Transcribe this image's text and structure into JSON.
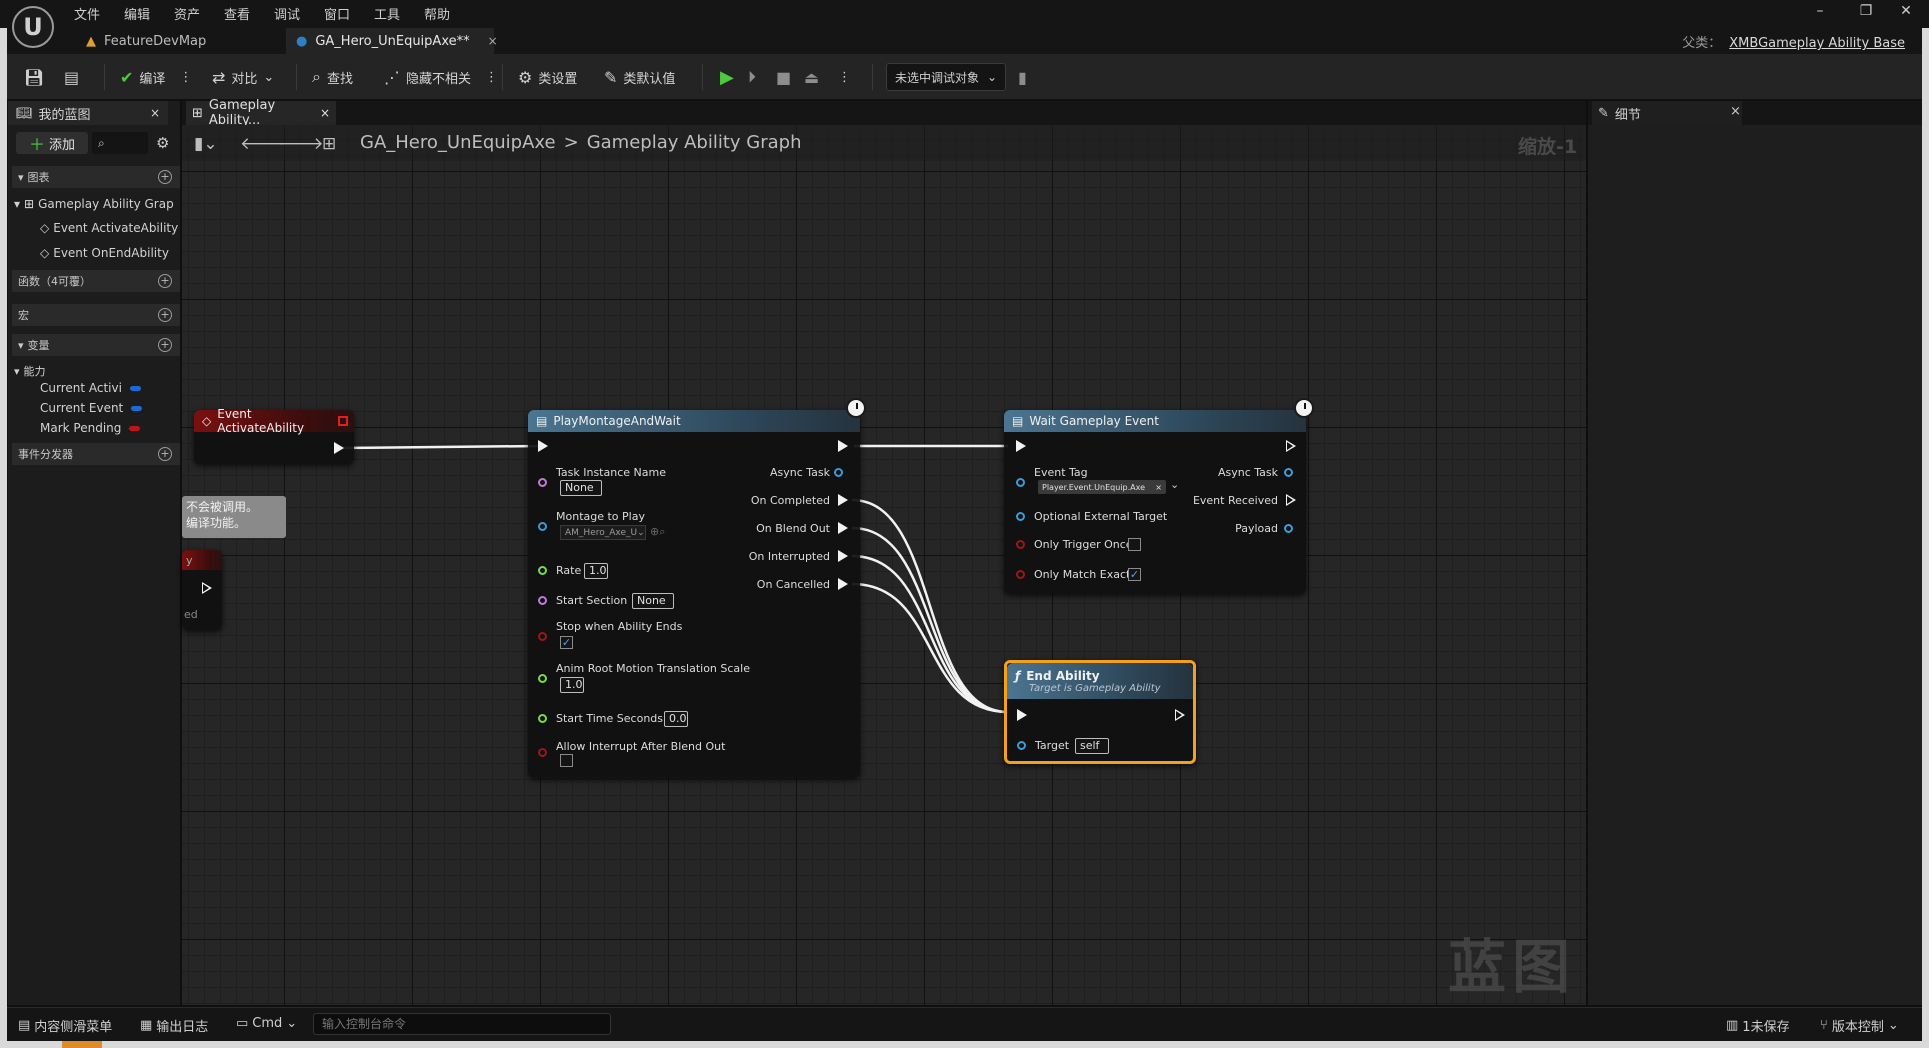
{
  "logo": "U",
  "menu": [
    "文件",
    "编辑",
    "资产",
    "查看",
    "调试",
    "窗口",
    "工具",
    "帮助"
  ],
  "window_controls": {
    "minimize": "–",
    "restore": "❐",
    "close": "✕"
  },
  "tabs": {
    "map_tab": "FeatureDevMap",
    "asset_tab": "GA_Hero_UnEquipAxe**",
    "close": "×"
  },
  "parent": {
    "label": "父类：",
    "value": "XMBGameplay Ability Base"
  },
  "toolbar": {
    "compile": "编译",
    "diff": "对比",
    "find": "查找",
    "hide_unrelated": "隐藏不相关",
    "class_settings": "类设置",
    "class_defaults": "类默认值",
    "debug_object": "未选中调试对象"
  },
  "my_blueprint": {
    "tab": "我的蓝图",
    "add": "添加",
    "search": "",
    "sections": {
      "graphs": "图表",
      "functions": "函数（4可覆）",
      "macros": "宏",
      "variables": "变量",
      "dispatchers": "事件分发器"
    },
    "graph_root": "Gameplay Ability Grap",
    "graph_items": [
      "Event ActivateAbility",
      "Event OnEndAbility"
    ],
    "var_category": "能力",
    "variables": [
      {
        "name": "Current Activi",
        "color": "#1d6ad6"
      },
      {
        "name": "Current Event",
        "color": "#1d6ad6"
      },
      {
        "name": "Mark Pending",
        "color": "#c21414"
      }
    ]
  },
  "graph": {
    "tab": "Gameplay Ability...",
    "breadcrumb": [
      "GA_Hero_UnEquipAxe",
      "Gameplay Graph"
    ],
    "breadcrumb_full_second": "Gameplay Ability Graph",
    "zoom": "缩放-1",
    "watermark": "蓝图",
    "comment_lines": [
      "不会被调用。",
      "编译功能。"
    ],
    "fragment_labels": [
      "y",
      "ed"
    ]
  },
  "nodes": {
    "event_activate": {
      "title": "Event ActivateAbility"
    },
    "play_montage": {
      "title": "PlayMontageAndWait",
      "inputs": {
        "task_instance_name": "Task Instance Name",
        "task_instance_value": "None",
        "montage_to_play": "Montage to Play",
        "montage_value": "AM_Hero_Axe_U",
        "rate": "Rate",
        "rate_value": "1.0",
        "start_section": "Start Section",
        "start_section_value": "None",
        "stop_when_ends": "Stop when Ability Ends",
        "anim_root_motion": "Anim Root Motion Translation Scale",
        "anim_root_motion_value": "1.0",
        "start_time": "Start Time Seconds",
        "start_time_value": "0.0",
        "allow_interrupt": "Allow Interrupt After Blend Out"
      },
      "outputs": [
        "Async Task",
        "On Completed",
        "On Blend Out",
        "On Interrupted",
        "On Cancelled"
      ]
    },
    "wait_gameplay_event": {
      "title": "Wait Gameplay Event",
      "inputs": {
        "event_tag": "Event Tag",
        "event_tag_value": "Player.Event.UnEquip.Axe",
        "optional_target": "Optional External Target",
        "only_trigger_once": "Only Trigger Once",
        "only_match_exact": "Only Match Exact"
      },
      "outputs": [
        "Async Task",
        "Event Received",
        "Payload"
      ]
    },
    "end_ability": {
      "title": "End Ability",
      "subtitle": "Target is Gameplay Ability",
      "target": "Target",
      "target_value": "self"
    }
  },
  "details": {
    "tab": "细节"
  },
  "statusbar": {
    "content_drawer": "内容侧滑菜单",
    "output_log": "输出日志",
    "cmd": "Cmd",
    "console_placeholder": "输入控制台命令",
    "unsaved": "1未保存",
    "source_control": "版本控制"
  }
}
